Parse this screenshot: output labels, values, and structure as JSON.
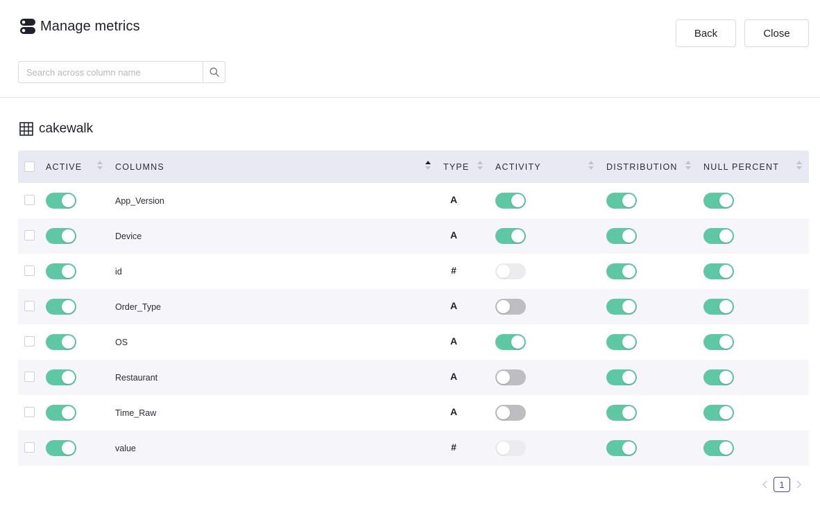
{
  "header": {
    "title": "Manage metrics",
    "title_icon": "database-toggle-icon",
    "back_label": "Back",
    "close_label": "Close"
  },
  "search": {
    "placeholder": "Search across column name",
    "value": "",
    "icon": "search-icon"
  },
  "table_section": {
    "title": "cakewalk",
    "icon": "table-grid-icon"
  },
  "columns_header": {
    "active": "ACTIVE",
    "columns": "COLUMNS",
    "type": "TYPE",
    "activity": "ACTIVITY",
    "distribution": "DISTRIBUTION",
    "null_percent": "NULL PERCENT"
  },
  "rows": [
    {
      "name": "App_Version",
      "type": "A",
      "active": "on",
      "activity": "on",
      "distribution": "on",
      "null_percent": "on"
    },
    {
      "name": "Device",
      "type": "A",
      "active": "on",
      "activity": "on",
      "distribution": "on",
      "null_percent": "on"
    },
    {
      "name": "id",
      "type": "#",
      "active": "on",
      "activity": "disabled",
      "distribution": "on",
      "null_percent": "on"
    },
    {
      "name": "Order_Type",
      "type": "A",
      "active": "on",
      "activity": "off",
      "distribution": "on",
      "null_percent": "on"
    },
    {
      "name": "OS",
      "type": "A",
      "active": "on",
      "activity": "on",
      "distribution": "on",
      "null_percent": "on"
    },
    {
      "name": "Restaurant",
      "type": "A",
      "active": "on",
      "activity": "off",
      "distribution": "on",
      "null_percent": "on"
    },
    {
      "name": "Time_Raw",
      "type": "A",
      "active": "on",
      "activity": "off",
      "distribution": "on",
      "null_percent": "on"
    },
    {
      "name": "value",
      "type": "#",
      "active": "on",
      "activity": "disabled",
      "distribution": "on",
      "null_percent": "on"
    }
  ],
  "pagination": {
    "current_page": "1"
  },
  "colors": {
    "toggle_on": "#5ec8a5",
    "toggle_off": "#bdbdc2",
    "toggle_disabled": "#ececef",
    "header_bg": "#e9e9f3",
    "pager_accent": "#4a3fbf"
  }
}
